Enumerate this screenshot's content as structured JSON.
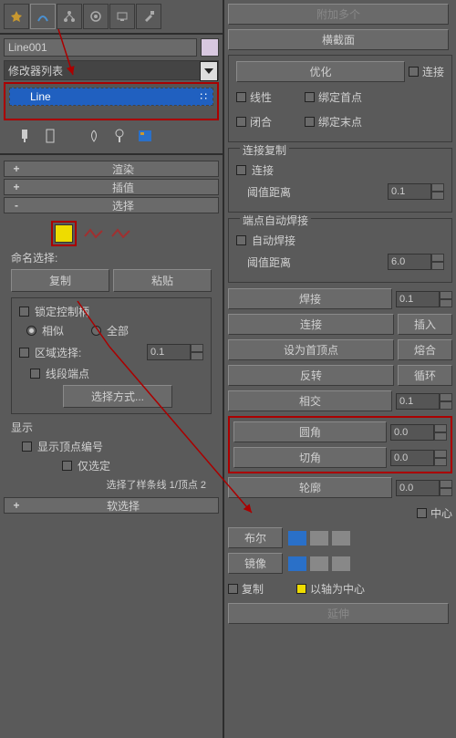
{
  "icons": [
    "star",
    "shape",
    "hierarchy",
    "motion",
    "display",
    "wrench"
  ],
  "left": {
    "object_name": "Line001",
    "modifier_list": "修改器列表",
    "stack_item": "Line",
    "rollups": {
      "render": "渲染",
      "interp": "插值",
      "selection": "选择",
      "softsel": "软选择"
    },
    "name_select_label": "命名选择:",
    "copy": "复制",
    "paste": "粘贴",
    "lock_handles": "锁定控制柄",
    "similar": "相似",
    "all": "全部",
    "area_select": "区域选择:",
    "area_val": "0.1",
    "seg_end": "线段端点",
    "select_by": "选择方式...",
    "display_label": "显示",
    "show_vert_num": "显示顶点编号",
    "selected_only": "仅选定",
    "status": "选择了样条线 1/顶点 2"
  },
  "right": {
    "attach_mult": "附加多个",
    "cross": "横截面",
    "optimize": "优化",
    "connect": "连接",
    "linear": "线性",
    "bind_first": "绑定首点",
    "closed": "闭合",
    "bind_last": "绑定末点",
    "conn_copy_title": "连接复制",
    "connect2": "连接",
    "thresh_dist": "阈值距离",
    "thresh_val": "0.1",
    "auto_weld_title": "端点自动焊接",
    "auto_weld": "自动焊接",
    "thresh_dist2": "阈值距离",
    "thresh_val2": "6.0",
    "weld": "焊接",
    "weld_val": "0.1",
    "connect3": "连接",
    "insert": "插入",
    "make_first": "设为首顶点",
    "fuse": "熔合",
    "reverse": "反转",
    "cycle": "循环",
    "cross_insert": "相交",
    "cross_val": "0.1",
    "fillet": "圆角",
    "fillet_val": "0.0",
    "chamfer": "切角",
    "chamfer_val": "0.0",
    "outline": "轮廓",
    "outline_val": "0.0",
    "center": "中心",
    "boolean": "布尔",
    "mirror": "镜像",
    "copy2": "复制",
    "about_axis": "以轴为中心",
    "extend": "延伸"
  }
}
